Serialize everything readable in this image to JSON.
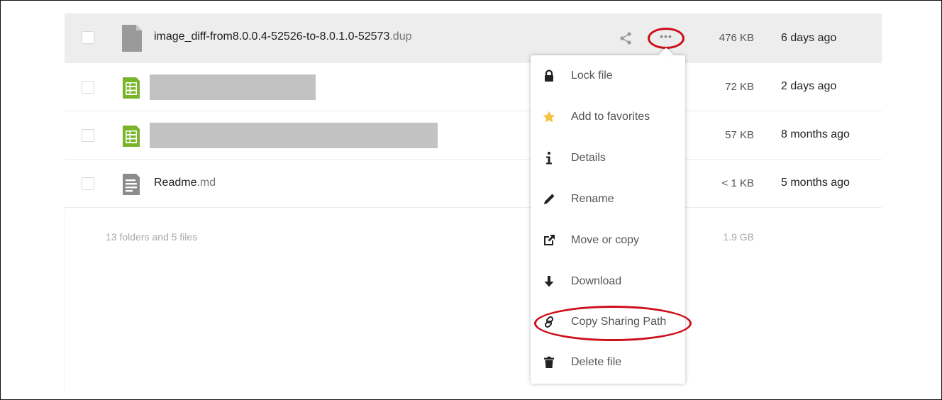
{
  "files": [
    {
      "name": "image_diff-from8.0.0.4-52526-to-8.0.1.0-52573",
      "ext": ".dup",
      "size": "476 KB",
      "modified": "6 days ago",
      "icon": "generic-file-icon"
    },
    {
      "name": "",
      "ext": "",
      "size": "72 KB",
      "modified": "2 days ago",
      "icon": "spreadsheet-icon"
    },
    {
      "name": "",
      "ext": "",
      "size": "57 KB",
      "modified": "8 months ago",
      "icon": "spreadsheet-icon"
    },
    {
      "name": "Readme",
      "ext": ".md",
      "size": "< 1 KB",
      "modified": "5 months ago",
      "icon": "text-file-icon"
    }
  ],
  "summary": {
    "text": "13 folders and 5 files",
    "size": "1.9 GB"
  },
  "menu": {
    "items": [
      {
        "label": "Lock file",
        "icon": "lock-icon"
      },
      {
        "label": "Add to favorites",
        "icon": "star-icon"
      },
      {
        "label": "Details",
        "icon": "info-icon"
      },
      {
        "label": "Rename",
        "icon": "pencil-icon"
      },
      {
        "label": "Move or copy",
        "icon": "external-link-icon"
      },
      {
        "label": "Download",
        "icon": "download-icon"
      },
      {
        "label": "Copy Sharing Path",
        "icon": "link-icon"
      },
      {
        "label": "Delete file",
        "icon": "trash-icon"
      }
    ]
  },
  "colors": {
    "highlight": "#cc0f1a",
    "spreadsheet": "#78b52a",
    "star": "#f5c542",
    "selected_row": "#ededed"
  }
}
